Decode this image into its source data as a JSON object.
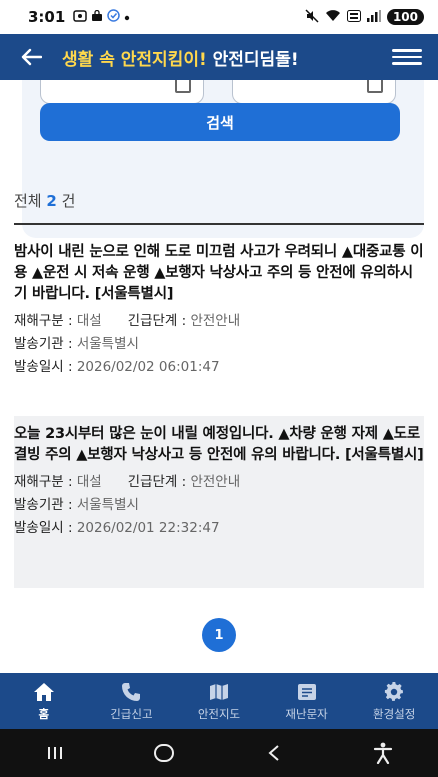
{
  "status_bar": {
    "time": "3:01",
    "left_icons": [
      "screenshot-icon",
      "bag-icon",
      "check-circle-icon"
    ],
    "battery": "100"
  },
  "header": {
    "title_accent": "생활 속 안전지킴이!",
    "title_main": "안전디딤돌!"
  },
  "search": {
    "button_label": "검색"
  },
  "results": {
    "total_prefix": "전체",
    "total_count": "2",
    "total_suffix": "건",
    "items": [
      {
        "text": "밤사이 내린 눈으로 인해 도로 미끄럼 사고가 우려되니 ▲대중교통 이용 ▲운전 시 저속 운행 ▲보행자 낙상사고 주의 등 안전에 유의하시기 바랍니다. [서울특별시]",
        "disaster_label": "재해구분 : ",
        "disaster_value": "대설",
        "level_label": "긴급단계 : ",
        "level_value": "안전안내",
        "agency_label": "발송기관 : ",
        "agency_value": "서울특별시",
        "date_label": "발송일시 : ",
        "date_value": "2026/02/02 06:01:47"
      },
      {
        "text": "오늘 23시부터 많은 눈이 내릴 예정입니다. ▲차량 운행 자제 ▲도로 결빙 주의 ▲보행자 낙상사고 등 안전에 유의 바랍니다. [서울특별시]",
        "disaster_label": "재해구분 : ",
        "disaster_value": "대설",
        "level_label": "긴급단계 : ",
        "level_value": "안전안내",
        "agency_label": "발송기관 : ",
        "agency_value": "서울특별시",
        "date_label": "발송일시 : ",
        "date_value": "2026/02/01 22:32:47"
      }
    ]
  },
  "pagination": {
    "current_page": "1"
  },
  "bottom_nav": {
    "items": [
      {
        "label": "홈",
        "icon": "home-icon",
        "active": true
      },
      {
        "label": "긴급신고",
        "icon": "phone-icon",
        "active": false
      },
      {
        "label": "안전지도",
        "icon": "map-icon",
        "active": false
      },
      {
        "label": "재난문자",
        "icon": "message-icon",
        "active": false
      },
      {
        "label": "환경설정",
        "icon": "gear-icon",
        "active": false
      }
    ]
  },
  "colors": {
    "header_bg": "#1c4a8a",
    "accent_yellow": "#ffd84d",
    "primary_blue": "#1f6fd6"
  }
}
